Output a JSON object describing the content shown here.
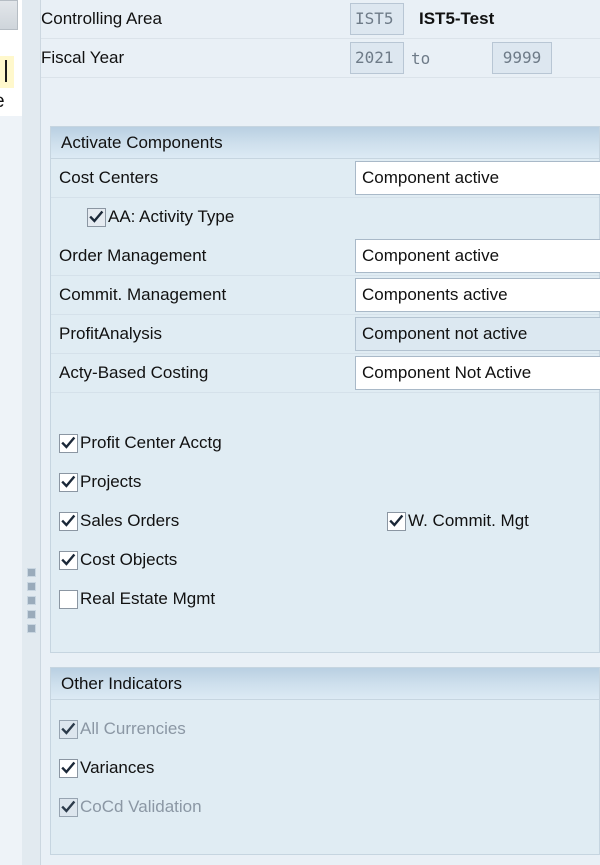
{
  "window": {
    "left_chrome_letter_fragment": "e"
  },
  "header_form": {
    "rows": [
      {
        "label": "Controlling Area",
        "field_value": "IST5",
        "description": "IST5-Test"
      },
      {
        "label": "Fiscal Year",
        "from_value": "2021",
        "separator": "to",
        "to_value": "9999"
      }
    ]
  },
  "activate_components": {
    "title": "Activate Components",
    "rows": [
      {
        "label": "Cost Centers",
        "value": "Component active",
        "disabled": false
      },
      {
        "label": "Order Management",
        "value": "Component active",
        "disabled": false
      },
      {
        "label": "Commit. Management",
        "value": "Components active",
        "disabled": false
      },
      {
        "label": "ProfitAnalysis",
        "value": "Component not active",
        "disabled": true
      },
      {
        "label": "Acty-Based Costing",
        "value": "Component Not Active",
        "disabled": false
      }
    ],
    "activity_type_checkbox": {
      "label": "AA: Activity Type",
      "checked": true
    },
    "checkboxes_left": [
      {
        "label": "Profit Center Acctg",
        "checked": true,
        "disabled": false
      },
      {
        "label": "Projects",
        "checked": true,
        "disabled": false
      },
      {
        "label": "Sales Orders",
        "checked": true,
        "disabled": false
      },
      {
        "label": "Cost Objects",
        "checked": true,
        "disabled": false
      },
      {
        "label": "Real Estate Mgmt",
        "checked": false,
        "disabled": false
      }
    ],
    "checkboxes_right": [
      {
        "label": "W. Commit. Mgt",
        "checked": true,
        "disabled": false
      }
    ]
  },
  "other_indicators": {
    "title": "Other Indicators",
    "checkboxes": [
      {
        "label": "All Currencies",
        "checked": true,
        "disabled": true
      },
      {
        "label": "Variances",
        "checked": true,
        "disabled": false
      },
      {
        "label": "CoCd Validation",
        "checked": true,
        "disabled": true
      }
    ]
  },
  "colors": {
    "pane_background": "#e9f0f6",
    "group_background": "#e0ecf3",
    "group_header_top": "#b9cfe2",
    "field_readonly": "#dde7f0",
    "field_editable": "#ffffff",
    "disabled_text": "#8b97a4"
  }
}
